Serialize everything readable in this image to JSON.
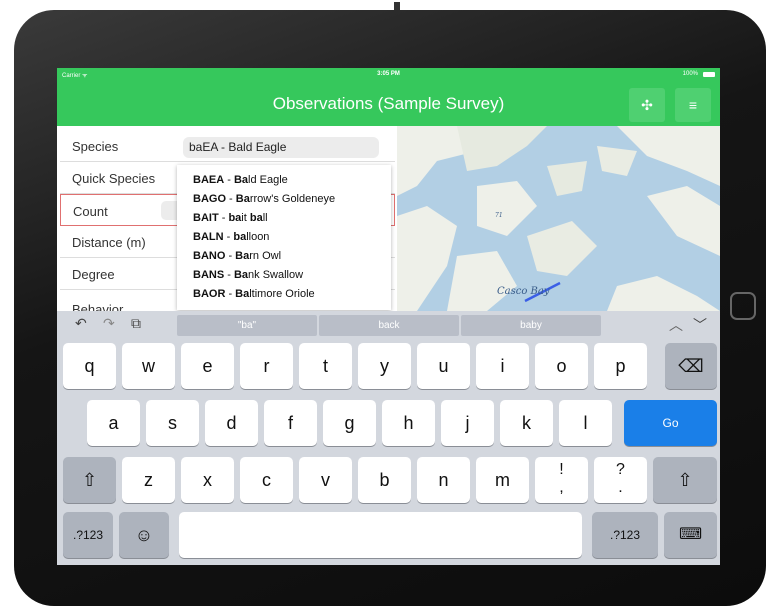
{
  "status": {
    "carrier": "Carrier ᯤ",
    "time": "3:05 PM",
    "battery": "100%"
  },
  "navbar": {
    "title": "Observations (Sample Survey)",
    "button1_icon": "move-icon",
    "button1_glyph": "✣",
    "button2_icon": "menu-icon",
    "button2_glyph": "≡"
  },
  "form": {
    "rows": [
      {
        "label": "Species"
      },
      {
        "label": "Quick Species"
      },
      {
        "label": "Count"
      },
      {
        "label": "Distance (m)"
      },
      {
        "label": "Degree"
      },
      {
        "label": "Behavior"
      }
    ],
    "species_value": "baEA - Bald Eagle"
  },
  "dropdown": {
    "items": [
      {
        "code": "BAEA",
        "rest": " - ",
        "bold": "Ba",
        "tail": "ld Eagle"
      },
      {
        "code": "BAGO",
        "rest": " - ",
        "bold": "Ba",
        "tail": "rrow's Goldeneye"
      },
      {
        "code": "BAIT",
        "rest": " - ",
        "bold": "ba",
        "tail": "it ",
        "bold2": "ba",
        "tail2": "ll"
      },
      {
        "code": "BALN",
        "rest": " - ",
        "bold": "ba",
        "tail": "lloon"
      },
      {
        "code": "BANO",
        "rest": " - ",
        "bold": "Ba",
        "tail": "rn Owl"
      },
      {
        "code": "BANS",
        "rest": " - ",
        "bold": "Ba",
        "tail": "nk Swallow"
      },
      {
        "code": "BAOR",
        "rest": " - ",
        "bold": "Ba",
        "tail": "ltimore Oriole"
      }
    ]
  },
  "map": {
    "label_bay": "Casco Bay",
    "label_71": "71"
  },
  "keyboard": {
    "suggestions": [
      "\"ba\"",
      "back",
      "baby"
    ],
    "row1": [
      "q",
      "w",
      "e",
      "r",
      "t",
      "y",
      "u",
      "i",
      "o",
      "p"
    ],
    "row2": [
      "a",
      "s",
      "d",
      "f",
      "g",
      "h",
      "j",
      "k",
      "l"
    ],
    "row3": [
      "z",
      "x",
      "c",
      "v",
      "b",
      "n",
      "m"
    ],
    "punct1": "!\n,",
    "punct2": "?\n.",
    "go": "Go",
    "numbers_left": ".?123",
    "numbers_right": ".?123",
    "colors": {
      "go": "#1a7fe8",
      "navbar": "#36c85c"
    }
  }
}
